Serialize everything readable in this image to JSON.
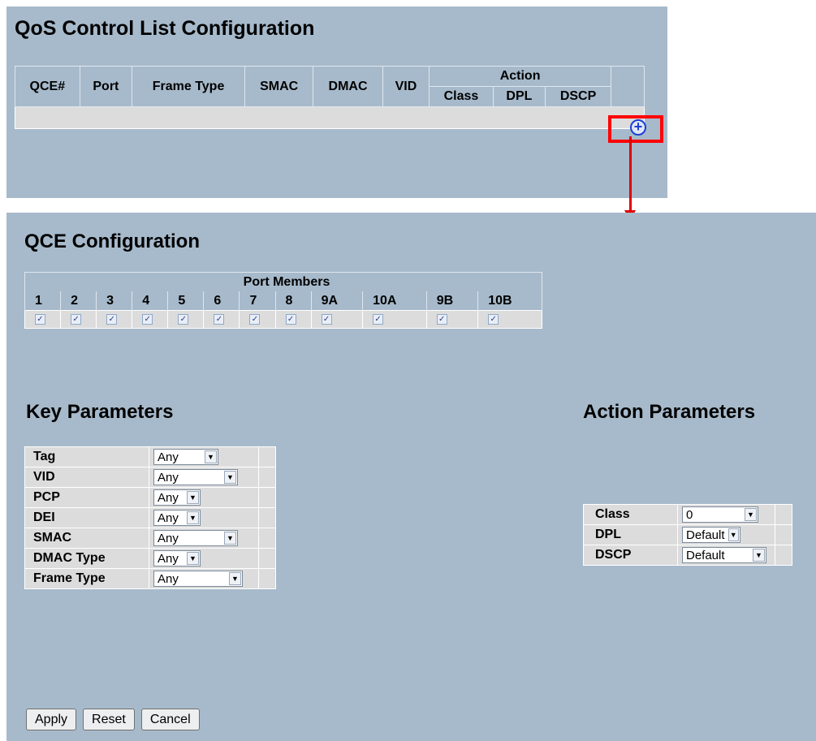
{
  "qcl": {
    "title": "QoS Control List Configuration",
    "columns": [
      "QCE#",
      "Port",
      "Frame Type",
      "SMAC",
      "DMAC",
      "VID"
    ],
    "action_group": "Action",
    "action_columns": [
      "Class",
      "DPL",
      "DSCP"
    ],
    "add_icon": "plus-circle-icon"
  },
  "qce": {
    "title": "QCE Configuration",
    "port_members_title": "Port Members",
    "ports": [
      "1",
      "2",
      "3",
      "4",
      "5",
      "6",
      "7",
      "8",
      "9A",
      "10A",
      "9B",
      "10B"
    ],
    "port_checked": [
      true,
      true,
      true,
      true,
      true,
      true,
      true,
      true,
      true,
      true,
      true,
      true
    ],
    "check_glyph": "✓"
  },
  "key_params": {
    "title": "Key Parameters",
    "rows": [
      {
        "label": "Tag",
        "value": "Any"
      },
      {
        "label": "VID",
        "value": "Any"
      },
      {
        "label": "PCP",
        "value": "Any"
      },
      {
        "label": "DEI",
        "value": "Any"
      },
      {
        "label": "SMAC",
        "value": "Any"
      },
      {
        "label": "DMAC Type",
        "value": "Any"
      },
      {
        "label": "Frame Type",
        "value": "Any"
      }
    ]
  },
  "action_params": {
    "title": "Action Parameters",
    "rows": [
      {
        "label": "Class",
        "value": "0"
      },
      {
        "label": "DPL",
        "value": "Default"
      },
      {
        "label": "DSCP",
        "value": "Default"
      }
    ]
  },
  "buttons": {
    "apply": "Apply",
    "reset": "Reset",
    "cancel": "Cancel"
  },
  "colors": {
    "panel_bg": "#a7bacb",
    "highlight": "#ff0000",
    "arrow": "#e00000",
    "add_icon": "#1c3fd4"
  }
}
